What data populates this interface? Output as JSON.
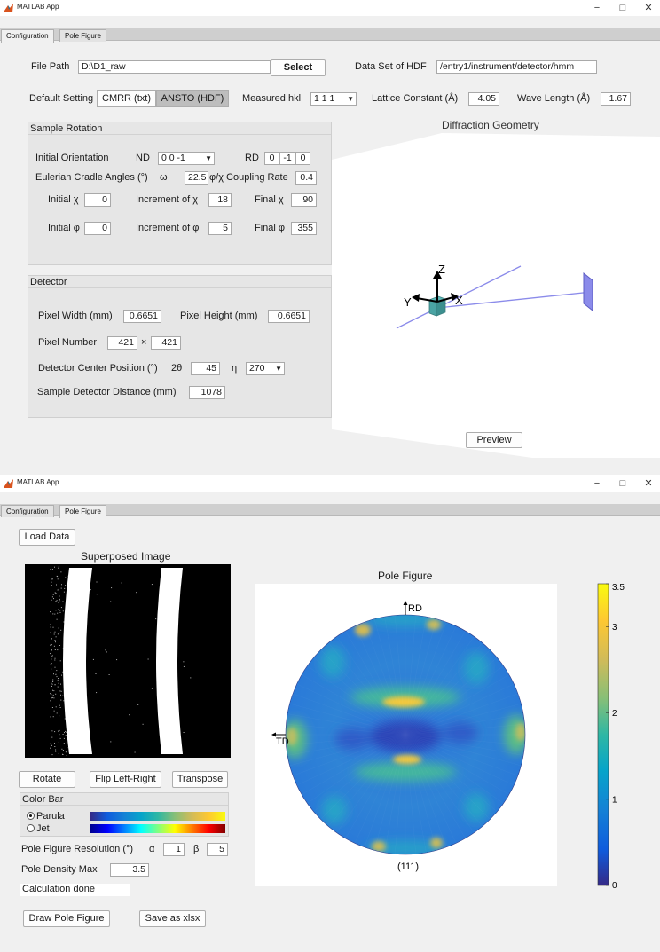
{
  "window1": {
    "title": "MATLAB App",
    "tabs": [
      "Configuration",
      "Pole Figure"
    ],
    "active_tab": "Configuration",
    "file_path": {
      "label": "File Path",
      "value": "D:\\D1_raw",
      "select_label": "Select"
    },
    "hdf": {
      "label": "Data Set of HDF",
      "value": "/entry1/instrument/detector/hmm"
    },
    "default_setting": {
      "label": "Default Setting",
      "options": [
        "CMRR (txt)",
        "ANSTO (HDF)"
      ],
      "selected": "ANSTO (HDF)"
    },
    "measured_hkl": {
      "label": "Measured hkl",
      "value": "1 1 1"
    },
    "lattice_constant": {
      "label": "Lattice Constant (Å)",
      "value": "4.05"
    },
    "wave_length": {
      "label": "Wave Length (Å)",
      "value": "1.67"
    },
    "sample_rotation": {
      "title": "Sample Rotation",
      "initial_orientation_label": "Initial Orientation",
      "nd_label": "ND",
      "nd_value": "0 0 -1",
      "rd_label": "RD",
      "rd_values": [
        "0",
        "-1",
        "0"
      ],
      "cradle_label": "Eulerian Cradle Angles (°)",
      "omega_label": "ω",
      "omega_value": "22.5",
      "coupling_label": "φ/χ Coupling Rate",
      "coupling_value": "0.4",
      "initial_chi_label": "Initial χ",
      "initial_chi": "0",
      "increment_chi_label": "Increment of χ",
      "increment_chi": "18",
      "final_chi_label": "Final χ",
      "final_chi": "90",
      "initial_phi_label": "Initial φ",
      "initial_phi": "0",
      "increment_phi_label": "Increment of φ",
      "increment_phi": "5",
      "final_phi_label": "Final φ",
      "final_phi": "355"
    },
    "detector": {
      "title": "Detector",
      "pixel_width_label": "Pixel Width (mm)",
      "pixel_width": "0.6651",
      "pixel_height_label": "Pixel Height (mm)",
      "pixel_height": "0.6651",
      "pixel_number_label": "Pixel Number",
      "pixel_number_x": "421",
      "times": "×",
      "pixel_number_y": "421",
      "center_label": "Detector Center Position (°)",
      "two_theta_label": "2θ",
      "two_theta": "45",
      "eta_label": "η",
      "eta": "270",
      "distance_label": "Sample Detector Distance (mm)",
      "distance": "1078"
    },
    "geometry": {
      "title": "Diffraction Geometry",
      "axis_z": "Z",
      "axis_y": "Y",
      "axis_x": "X",
      "preview_label": "Preview"
    }
  },
  "window2": {
    "title": "MATLAB App",
    "tabs": [
      "Configuration",
      "Pole Figure"
    ],
    "active_tab": "Pole Figure",
    "load_data_label": "Load Data",
    "superposed_title": "Superposed Image",
    "rotate_label": "Rotate",
    "flip_label": "Flip Left-Right",
    "transpose_label": "Transpose",
    "colorbar_group": {
      "title": "Color Bar",
      "options": [
        "Parula",
        "Jet"
      ],
      "selected": "Parula"
    },
    "resolution": {
      "label": "Pole Figure Resolution (°)",
      "alpha_label": "α",
      "alpha": "1",
      "beta_label": "β",
      "beta": "5"
    },
    "density_max": {
      "label": "Pole Density Max",
      "value": "3.5"
    },
    "status": "Calculation done",
    "draw_label": "Draw Pole Figure",
    "save_label": "Save as xlsx",
    "pole_figure": {
      "title": "Pole Figure",
      "rd_label": "RD",
      "td_label": "TD",
      "hkl_label": "(111)"
    },
    "colorbar_ticks": [
      "3.5",
      "3",
      "2",
      "1",
      "0"
    ],
    "colors": {
      "parula_low": "#352a87",
      "parula_mid": "#21b5a5",
      "parula_high": "#f9fb0e",
      "pole_base": "#2f7fd6"
    }
  }
}
